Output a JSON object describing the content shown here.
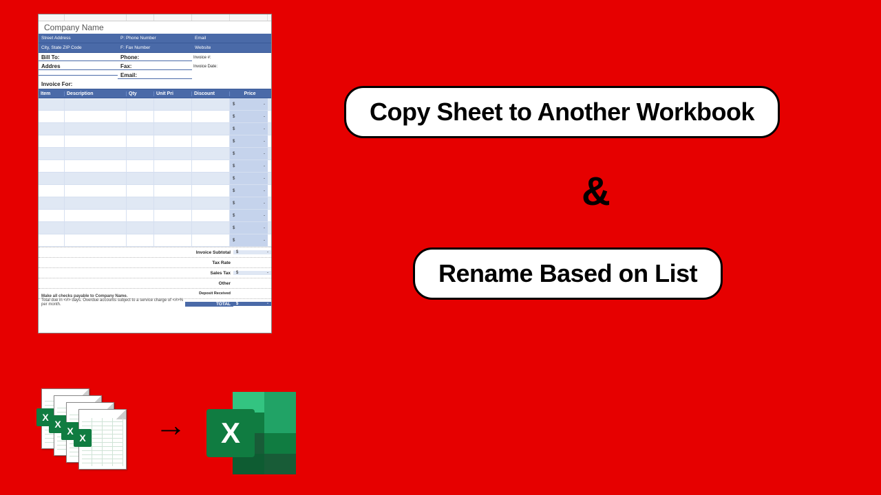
{
  "title1": "Copy Sheet to Another Workbook",
  "amp": "&",
  "title2": "Rename Based on List",
  "invoice": {
    "company": "Company Name",
    "row1": {
      "a": "Street Address",
      "b": "P: Phone Number",
      "c": "Email"
    },
    "row2": {
      "a": "City, State ZIP Code",
      "b": "F: Fax Number",
      "c": "Website"
    },
    "bill1": {
      "a": "Bill To:",
      "b": "Phone:",
      "c": "Invoice #:"
    },
    "bill2": {
      "a": "Addres",
      "b": "Fax:",
      "c": "Invoice Date:"
    },
    "bill3": {
      "a": "",
      "b": "Email:",
      "c": ""
    },
    "for": "Invoice For:",
    "headers": {
      "item": "Item",
      "desc": "Description",
      "qty": "Qty",
      "unit": "Unit Pri",
      "disc": "Discount",
      "price": "Price"
    },
    "cur": "$",
    "dash": "-",
    "totals": {
      "subtotal": "Invoice Subtotal",
      "taxrate": "Tax Rate",
      "salestax": "Sales Tax",
      "other": "Other",
      "deposit": "Deposit Received",
      "total": "TOTAL"
    },
    "foot1": "Make all checks payable to Company Name.",
    "foot2": "Total due in <#> days. Overdue accounts subject to a service charge of <#>% per month."
  },
  "arrow": "→",
  "excel_x": "X"
}
